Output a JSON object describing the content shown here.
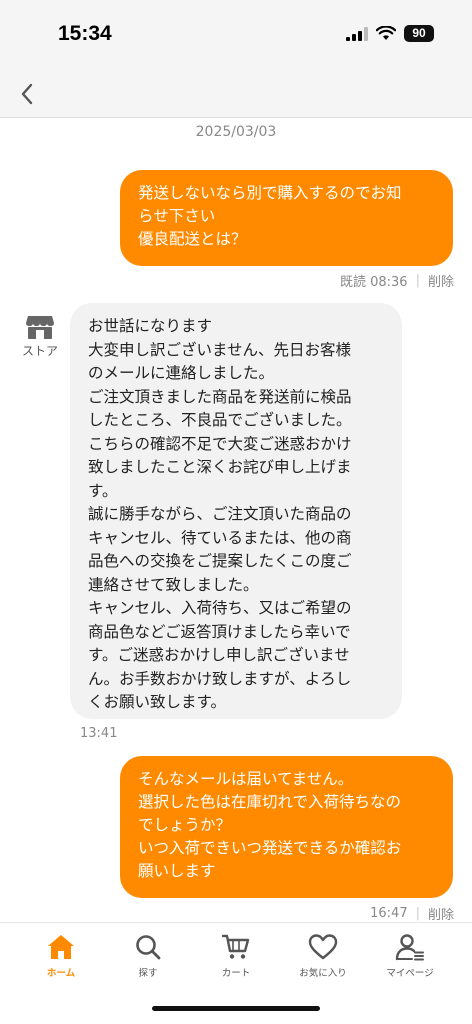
{
  "status_bar": {
    "time": "15:34",
    "battery": "90"
  },
  "chat": {
    "date": "2025/03/03",
    "messages": [
      {
        "direction": "out",
        "text": "発送しないなら別で購入するのでお知\nらせ下さい\n優良配送とは？",
        "meta_time": "既読 08:36",
        "delete_label": "削除"
      },
      {
        "direction": "in",
        "sender_label": "ストア",
        "text": "お世話になります\n大変申し訳ございません、先日お客様\nのメールに連絡しました。\nご注文頂きました商品を発送前に検品\nしたところ、不良品でございました。\nこちらの確認不足で大変ご迷惑おかけ\n致しましたこと深くお詫び申し上げま\nす。\n誠に勝手ながら、ご注文頂いた商品の\nキャンセル、待ているまたは、他の商\n品色への交換をご提案したくこの度ご\n連絡させて致しました。\nキャンセル、入荷待ち、又はご希望の\n商品色などご返答頂けましたら幸いで\nす。ご迷惑おかけし申し訳ございませ\nん。お手数おかけ致しますが、よろし\nくお願い致します。",
        "time": "13:41"
      },
      {
        "direction": "out",
        "text": "そんなメールは届いてません。\n選択した色は在庫切れで入荷待ちなの\nでしょうか？\nいつ入荷できいつ発送できるか確認お\n願いします",
        "meta_time": "16:47",
        "delete_label": "削除"
      }
    ]
  },
  "tab_bar": {
    "active": "home",
    "tabs": [
      {
        "id": "home",
        "label": "ホーム",
        "icon": "home-icon"
      },
      {
        "id": "search",
        "label": "探す",
        "icon": "search-icon"
      },
      {
        "id": "cart",
        "label": "カート",
        "icon": "cart-icon"
      },
      {
        "id": "favorites",
        "label": "お気に入り",
        "icon": "heart-icon"
      },
      {
        "id": "mypage",
        "label": "マイページ",
        "icon": "person-icon"
      }
    ]
  },
  "colors": {
    "accent": "#ff8a00",
    "incoming_bubble": "#f2f2f2",
    "meta_text": "#888888"
  }
}
